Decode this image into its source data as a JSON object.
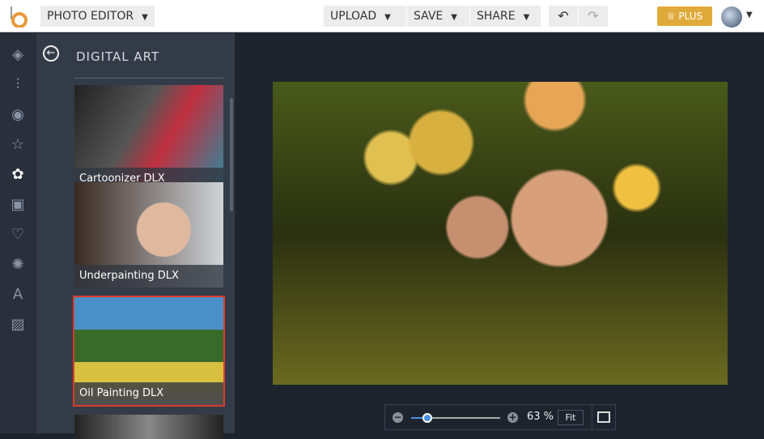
{
  "header": {
    "app_menu": "PHOTO EDITOR",
    "upload": "UPLOAD",
    "save": "SAVE",
    "share": "SHARE",
    "plus": "PLUS"
  },
  "panel": {
    "title": "DIGITAL ART",
    "items": [
      {
        "label": "Cartoonizer DLX"
      },
      {
        "label": "Underpainting DLX"
      },
      {
        "label": "Oil Painting DLX",
        "selected": true
      }
    ]
  },
  "zoom": {
    "value": "63 %",
    "fit": "Fit",
    "slider_fraction": 0.18
  },
  "colors": {
    "accent": "#e0aa3a",
    "selected": "#e03a2a",
    "slider": "#4a90e2"
  }
}
